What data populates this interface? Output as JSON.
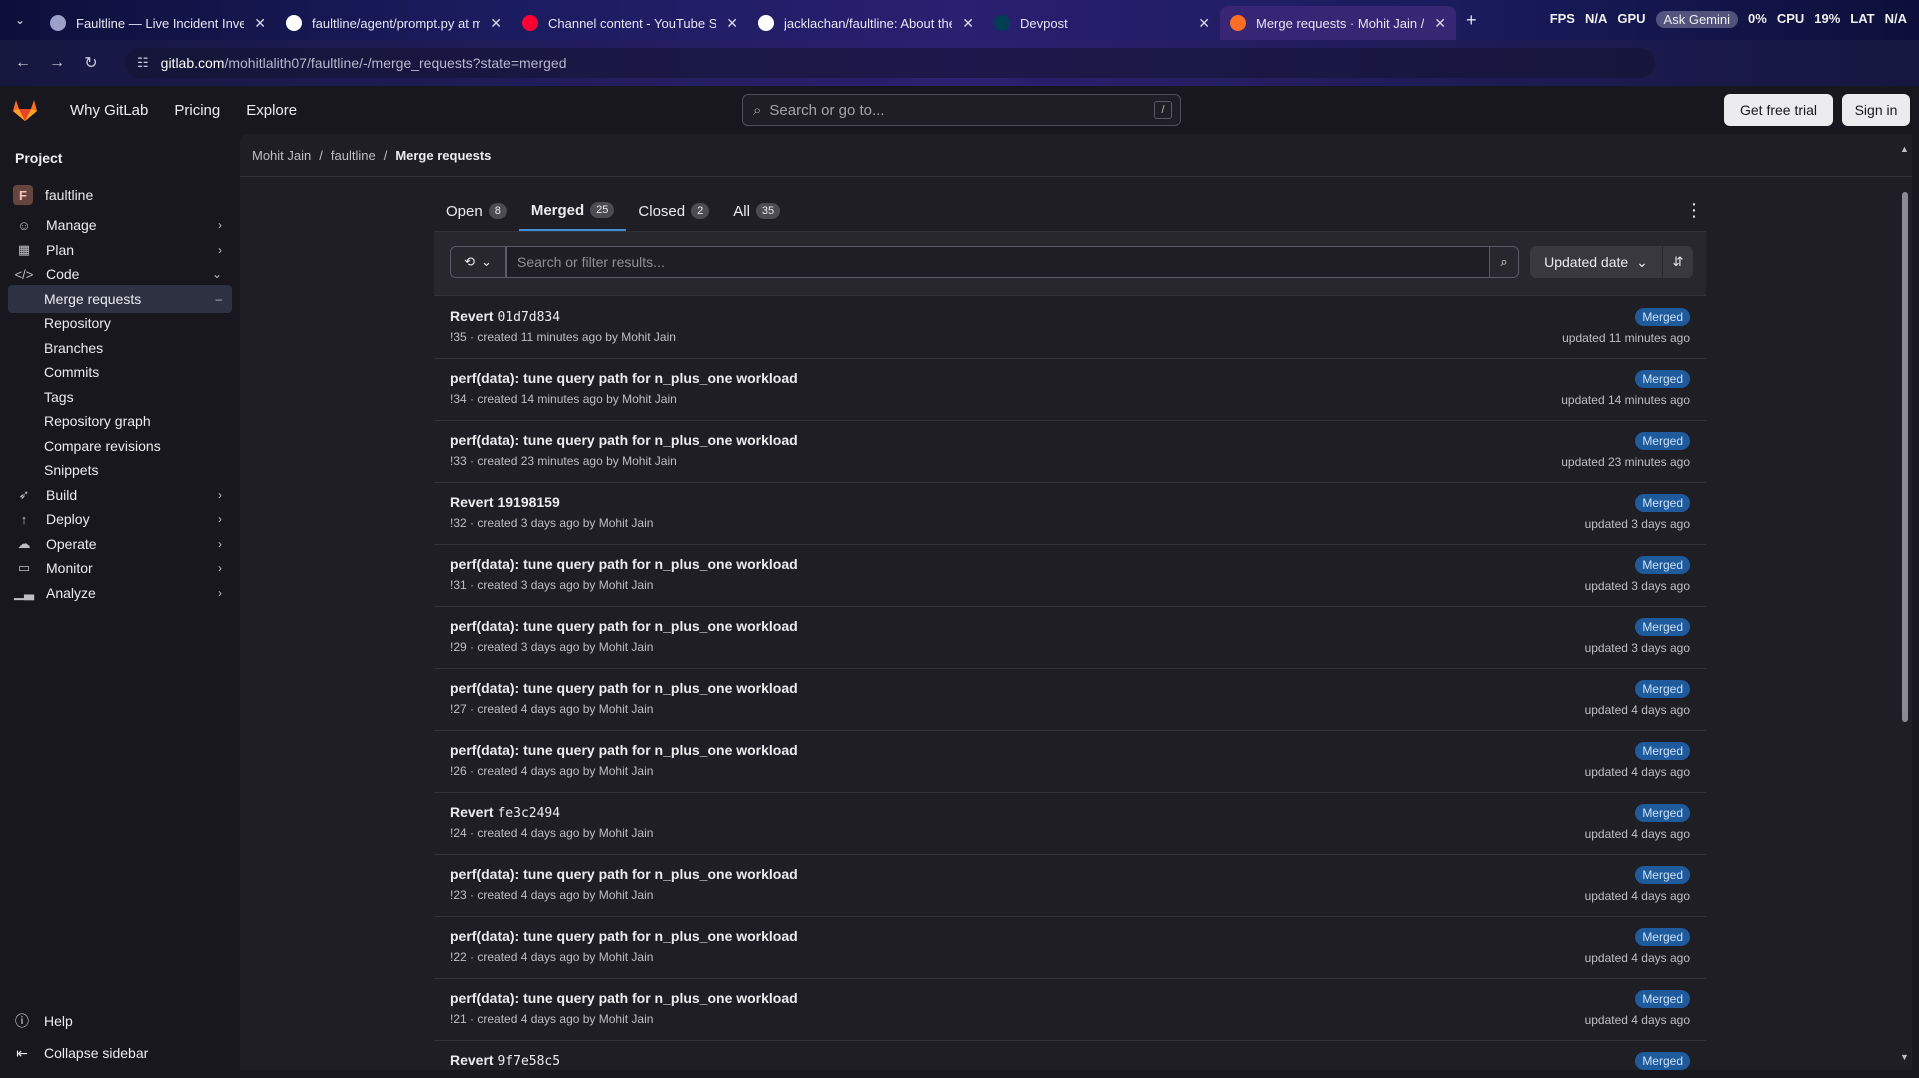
{
  "browser": {
    "tabs": [
      {
        "title": "Faultline — Live Incident Invest",
        "icon": "globe-icon",
        "color": "#9aa0c8"
      },
      {
        "title": "faultline/agent/prompt.py at m",
        "icon": "github-icon",
        "color": "#ffffff"
      },
      {
        "title": "Channel content - YouTube Stu",
        "icon": "youtube-icon",
        "color": "#ff0033"
      },
      {
        "title": "jacklachan/faultline: About the",
        "icon": "github-icon",
        "color": "#ffffff"
      },
      {
        "title": "Devpost",
        "icon": "devpost-icon",
        "color": "#003e54"
      },
      {
        "title": "Merge requests · Mohit Jain / fa",
        "icon": "gitlab-icon",
        "color": "#fc6d26"
      }
    ],
    "url_host": "gitlab.com",
    "url_path": "/mohitlalith07/faultline/-/merge_requests?state=merged",
    "perf": {
      "fps_label": "FPS",
      "fps_value": "N/A",
      "gpu_label": "GPU",
      "gpu_pill": "Ask Gemini",
      "gpu_value": "0%",
      "cpu_label": "CPU",
      "cpu_value": "19%",
      "lat_label": "LAT",
      "lat_value": "N/A"
    }
  },
  "header": {
    "nav": [
      "Why GitLab",
      "Pricing",
      "Explore"
    ],
    "search_placeholder": "Search or go to...",
    "search_shortcut": "/",
    "trial_label": "Get free trial",
    "signin_label": "Sign in"
  },
  "sidebar": {
    "section": "Project",
    "project_initial": "F",
    "project_name": "faultline",
    "items": [
      {
        "label": "Manage",
        "icon": "users-icon",
        "expandable": true
      },
      {
        "label": "Plan",
        "icon": "calendar-icon",
        "expandable": true
      },
      {
        "label": "Code",
        "icon": "code-icon",
        "expandable": true,
        "expanded": true
      }
    ],
    "code_subitems": [
      "Merge requests",
      "Repository",
      "Branches",
      "Commits",
      "Tags",
      "Repository graph",
      "Compare revisions",
      "Snippets"
    ],
    "items_after": [
      {
        "label": "Build",
        "icon": "rocket-icon"
      },
      {
        "label": "Deploy",
        "icon": "deploy-icon"
      },
      {
        "label": "Operate",
        "icon": "cloud-icon"
      },
      {
        "label": "Monitor",
        "icon": "monitor-icon"
      },
      {
        "label": "Analyze",
        "icon": "chart-icon"
      }
    ],
    "help_label": "Help",
    "collapse_label": "Collapse sidebar"
  },
  "breadcrumb": [
    "Mohit Jain",
    "faultline",
    "Merge requests"
  ],
  "tabs": [
    {
      "label": "Open",
      "count": "8"
    },
    {
      "label": "Merged",
      "count": "25",
      "active": true
    },
    {
      "label": "Closed",
      "count": "2"
    },
    {
      "label": "All",
      "count": "35"
    }
  ],
  "filter": {
    "placeholder": "Search or filter results...",
    "sort_label": "Updated date"
  },
  "merge_requests": [
    {
      "title_prefix": "Revert ",
      "title_code": "01d7d834",
      "title": "",
      "meta": "!35 · created 11 minutes ago by Mohit Jain",
      "badge": "Merged",
      "updated": "updated 11 minutes ago"
    },
    {
      "title_prefix": "",
      "title_code": "",
      "title": "perf(data): tune query path for n_plus_one workload",
      "meta": "!34 · created 14 minutes ago by Mohit Jain",
      "badge": "Merged",
      "updated": "updated 14 minutes ago"
    },
    {
      "title_prefix": "",
      "title_code": "",
      "title": "perf(data): tune query path for n_plus_one workload",
      "meta": "!33 · created 23 minutes ago by Mohit Jain",
      "badge": "Merged",
      "updated": "updated 23 minutes ago"
    },
    {
      "title_prefix": "",
      "title_code": "",
      "title": "Revert 19198159",
      "meta": "!32 · created 3 days ago by Mohit Jain",
      "badge": "Merged",
      "updated": "updated 3 days ago"
    },
    {
      "title_prefix": "",
      "title_code": "",
      "title": "perf(data): tune query path for n_plus_one workload",
      "meta": "!31 · created 3 days ago by Mohit Jain",
      "badge": "Merged",
      "updated": "updated 3 days ago"
    },
    {
      "title_prefix": "",
      "title_code": "",
      "title": "perf(data): tune query path for n_plus_one workload",
      "meta": "!29 · created 3 days ago by Mohit Jain",
      "badge": "Merged",
      "updated": "updated 3 days ago"
    },
    {
      "title_prefix": "",
      "title_code": "",
      "title": "perf(data): tune query path for n_plus_one workload",
      "meta": "!27 · created 4 days ago by Mohit Jain",
      "badge": "Merged",
      "updated": "updated 4 days ago"
    },
    {
      "title_prefix": "",
      "title_code": "",
      "title": "perf(data): tune query path for n_plus_one workload",
      "meta": "!26 · created 4 days ago by Mohit Jain",
      "badge": "Merged",
      "updated": "updated 4 days ago"
    },
    {
      "title_prefix": "Revert ",
      "title_code": "fe3c2494",
      "title": "",
      "meta": "!24 · created 4 days ago by Mohit Jain",
      "badge": "Merged",
      "updated": "updated 4 days ago"
    },
    {
      "title_prefix": "",
      "title_code": "",
      "title": "perf(data): tune query path for n_plus_one workload",
      "meta": "!23 · created 4 days ago by Mohit Jain",
      "badge": "Merged",
      "updated": "updated 4 days ago"
    },
    {
      "title_prefix": "",
      "title_code": "",
      "title": "perf(data): tune query path for n_plus_one workload",
      "meta": "!22 · created 4 days ago by Mohit Jain",
      "badge": "Merged",
      "updated": "updated 4 days ago"
    },
    {
      "title_prefix": "",
      "title_code": "",
      "title": "perf(data): tune query path for n_plus_one workload",
      "meta": "!21 · created 4 days ago by Mohit Jain",
      "badge": "Merged",
      "updated": "updated 4 days ago"
    },
    {
      "title_prefix": "Revert ",
      "title_code": "9f7e58c5",
      "title": "",
      "meta": "",
      "badge": "Merged",
      "updated": ""
    }
  ]
}
